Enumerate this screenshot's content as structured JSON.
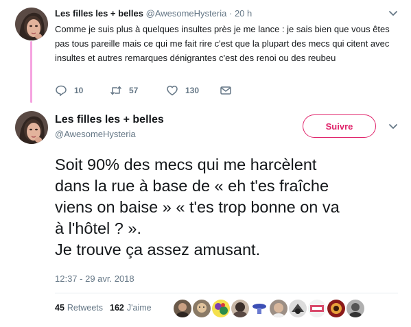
{
  "colors": {
    "accent": "#e0246b",
    "thread_line": "#f5a3e0",
    "secondary_text": "#657786",
    "primary_text": "#14171a"
  },
  "tweet1": {
    "name": "Les filles les + belles",
    "handle": "@AwesomeHysteria",
    "dot": "·",
    "time": "20 h",
    "text": "Comme je suis plus à quelques insultes près je me lance : je sais bien que vous êtes pas tous pareille mais ce qui me fait rire c'est que la plupart des mecs qui citent avec insultes et autres remarques dénigrantes c'est des renoi ou des reubeu",
    "actions": {
      "reply_count": "10",
      "retweet_count": "57",
      "like_count": "130",
      "reply_icon": "reply-icon",
      "retweet_icon": "retweet-icon",
      "like_icon": "heart-icon",
      "dm_icon": "envelope-icon"
    }
  },
  "tweet2": {
    "name": "Les filles les + belles",
    "handle": "@AwesomeHysteria",
    "follow_label": "Suivre",
    "text_lines": [
      "Soit 90% des mecs qui me harcèlent",
      "dans la rue à base de « eh t'es fraîche",
      "viens on baise » « t'es trop bonne on va",
      "à l'hôtel ? ».",
      "Je trouve ça assez amusant."
    ],
    "date": "12:37 - 29 avr. 2018",
    "retweets_count": "45",
    "retweets_label": "Retweets",
    "likes_count": "162",
    "likes_label": "J'aime",
    "liker_avatars": [
      "avatar",
      "avatar",
      "avatar",
      "avatar",
      "avatar",
      "avatar",
      "avatar",
      "avatar",
      "avatar",
      "avatar"
    ]
  }
}
